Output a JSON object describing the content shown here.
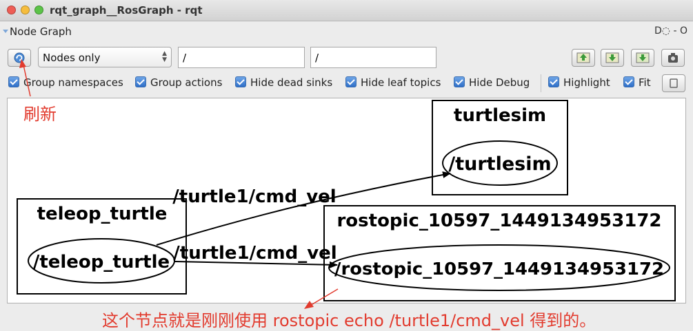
{
  "window": {
    "title": "rqt_graph__RosGraph - rqt"
  },
  "plugin": {
    "title": "Node Graph",
    "controls": "D◌  - O"
  },
  "toolbar": {
    "mode": "Nodes only",
    "filter1": "/",
    "filter2": "/"
  },
  "options": {
    "group_namespaces": "Group namespaces",
    "group_actions": "Group actions",
    "hide_dead_sinks": "Hide dead sinks",
    "hide_leaf_topics": "Hide leaf topics",
    "hide_debug": "Hide Debug",
    "highlight": "Highlight",
    "fit": "Fit"
  },
  "graph": {
    "clusters": {
      "turtlesim": "turtlesim",
      "teleop": "teleop_turtle",
      "rostopic": "rostopic_10597_1449134953172"
    },
    "nodes": {
      "turtlesim": "/turtlesim",
      "teleop": "/teleop_turtle",
      "rostopic": "/rostopic_10597_1449134953172"
    },
    "edges": {
      "to_turtlesim": "/turtle1/cmd_vel",
      "to_rostopic": "/turtle1/cmd_vel"
    }
  },
  "annotations": {
    "refresh": "刷新",
    "node_note": "这个节点就是刚刚使用 rostopic echo /turtle1/cmd_vel 得到的。"
  },
  "colors": {
    "annotation": "#e23b2e",
    "checkbox": "#3b7ad6"
  },
  "icons": [
    "refresh-icon",
    "load-dot-icon",
    "save-dot-icon",
    "save-image-icon",
    "screenshot-icon",
    "fit-icon"
  ]
}
